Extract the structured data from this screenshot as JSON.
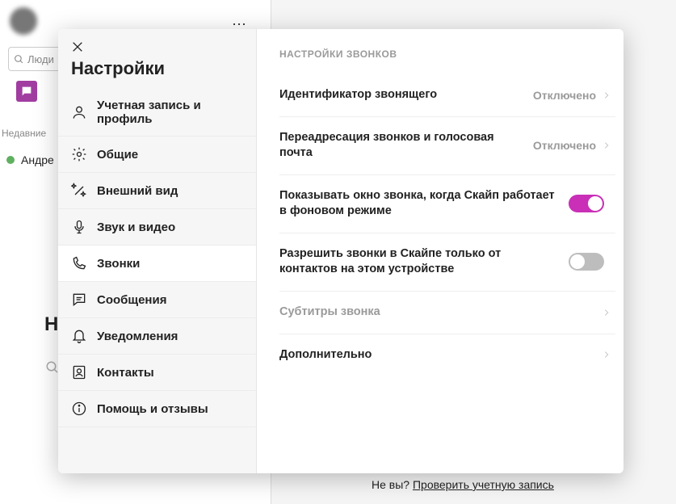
{
  "bg": {
    "search_placeholder": "Люди",
    "recent_label": "Недавние",
    "contact_name": "Андре",
    "big_letter": "Н",
    "footer_prefix": "Не вы? ",
    "footer_link": "Проверить учетную запись"
  },
  "settings": {
    "title": "Настройки",
    "nav": [
      {
        "id": "account",
        "label": "Учетная запись и профиль"
      },
      {
        "id": "general",
        "label": "Общие"
      },
      {
        "id": "appearance",
        "label": "Внешний вид"
      },
      {
        "id": "audio",
        "label": "Звук и видео"
      },
      {
        "id": "calls",
        "label": "Звонки"
      },
      {
        "id": "messages",
        "label": "Сообщения"
      },
      {
        "id": "notifications",
        "label": "Уведомления"
      },
      {
        "id": "contacts",
        "label": "Контакты"
      },
      {
        "id": "help",
        "label": "Помощь и отзывы"
      }
    ],
    "section_header": "НАСТРОЙКИ ЗВОНКОВ",
    "rows": {
      "caller_id": {
        "label": "Идентификатор звонящего",
        "value": "Отключено"
      },
      "forward": {
        "label": "Переадресация звонков и голосовая почта",
        "value": "Отключено"
      },
      "show_window": {
        "label": "Показывать окно звонка, когда Скайп работает в фоновом режиме"
      },
      "contacts_only": {
        "label": "Разрешить звонки в Скайпе только от контактов на этом устройстве"
      },
      "subtitles": {
        "label": "Субтитры звонка"
      },
      "advanced": {
        "label": "Дополнительно"
      }
    }
  }
}
